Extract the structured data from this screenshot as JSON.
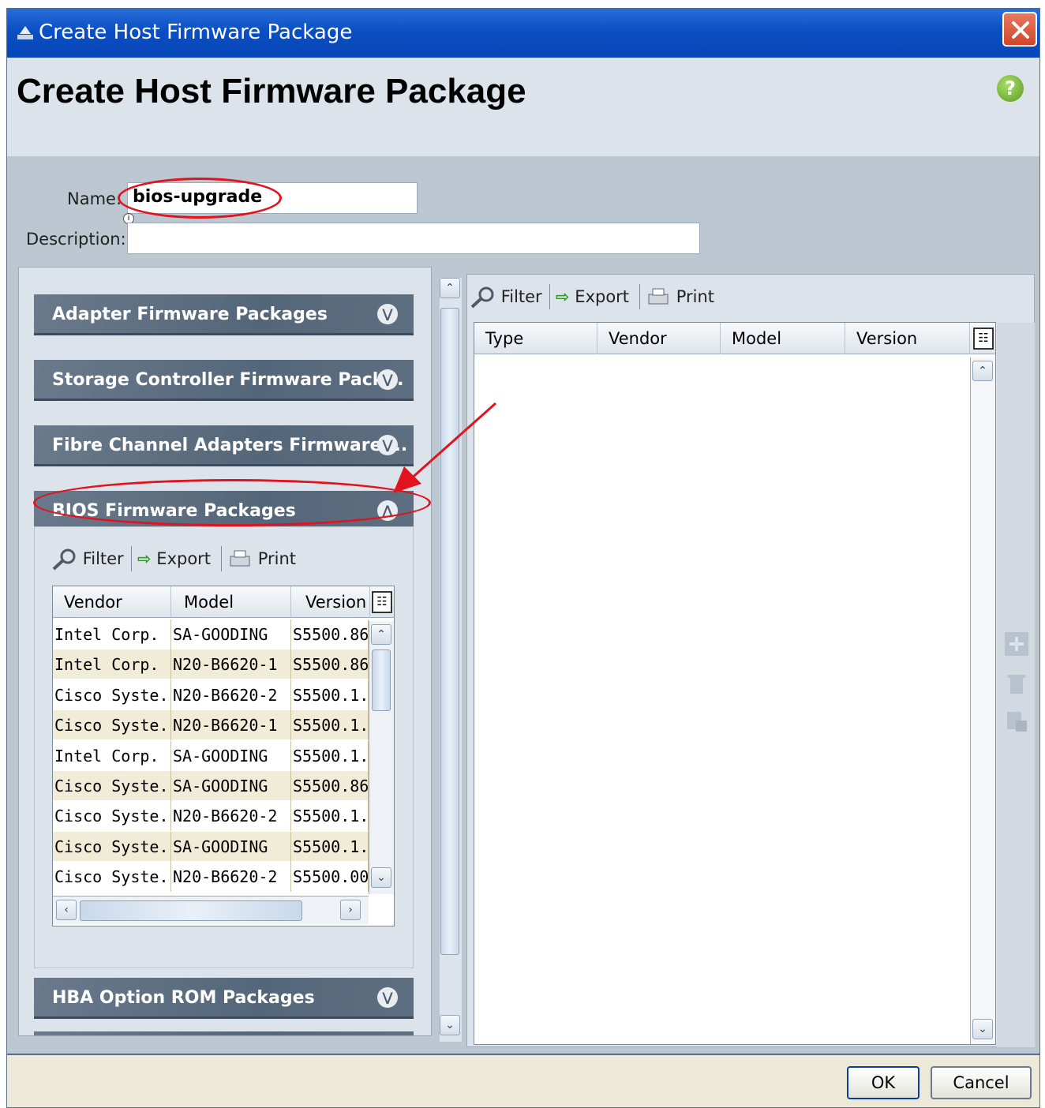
{
  "window": {
    "title": "Create Host Firmware Package"
  },
  "header": {
    "page_title": "Create Host Firmware Package",
    "help_icon": "?"
  },
  "form": {
    "name_label": "Name:",
    "name_value": "bios-upgrade",
    "description_label": "Description:",
    "description_value": ""
  },
  "left_panel": {
    "sections": [
      {
        "label": "Adapter Firmware Packages",
        "expanded": false
      },
      {
        "label": "Storage Controller Firmware Pack...",
        "expanded": false
      },
      {
        "label": "Fibre Channel Adapters Firmware ...",
        "expanded": false
      },
      {
        "label": "BIOS Firmware Packages",
        "expanded": true
      },
      {
        "label": "HBA Option ROM Packages",
        "expanded": false
      }
    ],
    "bios_toolbar": {
      "filter": "Filter",
      "export": "Export",
      "print": "Print"
    },
    "bios_grid": {
      "columns": [
        "Vendor",
        "Model",
        "Version"
      ],
      "rows": [
        [
          "Intel Corp.",
          "SA-GOODING",
          "S5500.86"
        ],
        [
          "Intel Corp.",
          "N20-B6620-1",
          "S5500.86"
        ],
        [
          "Cisco Syste...",
          "N20-B6620-2",
          "S5500.1."
        ],
        [
          "Cisco Syste...",
          "N20-B6620-1",
          "S5500.1."
        ],
        [
          "Intel Corp.",
          "SA-GOODING",
          "S5500.1."
        ],
        [
          "Cisco Syste...",
          "SA-GOODING",
          "S5500.86"
        ],
        [
          "Cisco Syste...",
          "N20-B6620-2",
          "S5500.1."
        ],
        [
          "Cisco Syste...",
          "SA-GOODING",
          "S5500.1."
        ],
        [
          "Cisco Syste...",
          "N20-B6620-2",
          "S5500.00"
        ]
      ]
    }
  },
  "right_panel": {
    "toolbar": {
      "filter": "Filter",
      "export": "Export",
      "print": "Print"
    },
    "columns": [
      "Type",
      "Vendor",
      "Model",
      "Version"
    ]
  },
  "footer": {
    "ok": "OK",
    "cancel": "Cancel"
  },
  "colors": {
    "annotation": "#e0141e",
    "title_bar": "#0a4fc4",
    "section_header": "#546679"
  }
}
